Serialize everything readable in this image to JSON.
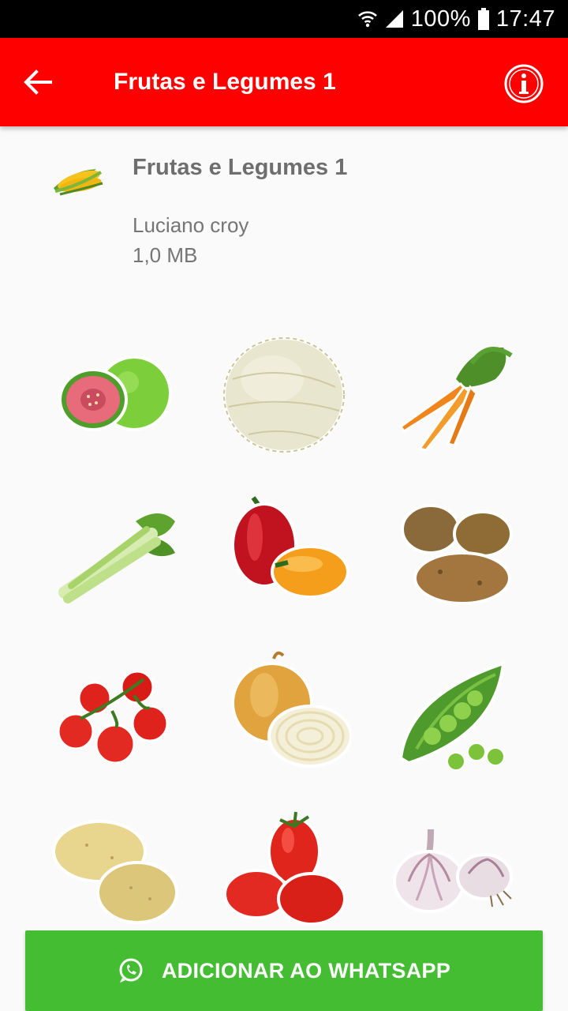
{
  "status_bar": {
    "battery": "100%",
    "time": "17:47"
  },
  "toolbar": {
    "title": "Frutas e Legumes 1"
  },
  "pack": {
    "name": "Frutas e Legumes 1",
    "author": "Luciano croy",
    "size": "1,0 MB",
    "icon": "corn-icon"
  },
  "stickers": [
    {
      "name": "guava-sticker"
    },
    {
      "name": "melon-sticker"
    },
    {
      "name": "carrot-sticker"
    },
    {
      "name": "celery-sticker"
    },
    {
      "name": "bell-pepper-sticker"
    },
    {
      "name": "potato-sticker"
    },
    {
      "name": "tomato-vine-sticker"
    },
    {
      "name": "onion-sticker"
    },
    {
      "name": "peas-sticker"
    },
    {
      "name": "yellow-potato-sticker"
    },
    {
      "name": "plum-tomato-sticker"
    },
    {
      "name": "garlic-sticker"
    }
  ],
  "add_button": {
    "label": "ADICIONAR AO WHATSAPP",
    "icon": "whatsapp-icon"
  },
  "colors": {
    "toolbar": "#ff0000",
    "button": "#45bd32",
    "status_bar": "#000000"
  }
}
